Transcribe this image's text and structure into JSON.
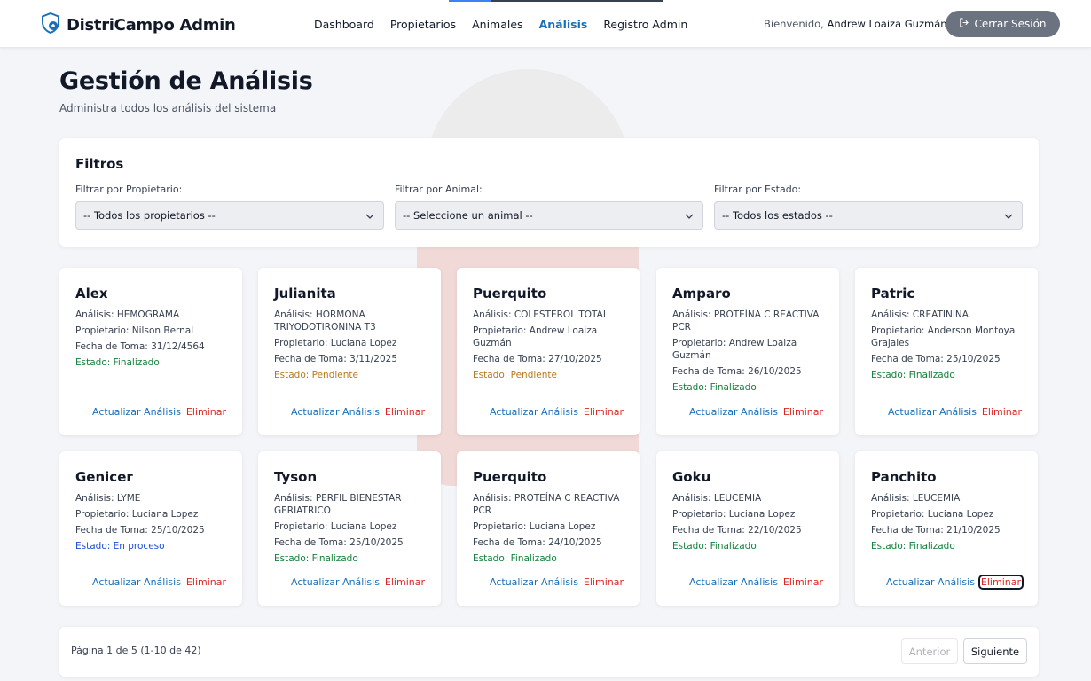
{
  "brand": {
    "name": "DistriCampo Admin"
  },
  "nav": {
    "items": [
      {
        "label": "Dashboard"
      },
      {
        "label": "Propietarios"
      },
      {
        "label": "Animales"
      },
      {
        "label": "Análisis"
      },
      {
        "label": "Registro Admin"
      }
    ],
    "active": "Análisis"
  },
  "user": {
    "welcome_prefix": "Bienvenido,",
    "name": "Andrew Loaiza Guzmán",
    "logout_label": "Cerrar Sesión"
  },
  "page": {
    "title": "Gestión de Análisis",
    "subtitle": "Administra todos los análisis del sistema"
  },
  "filters": {
    "title": "Filtros",
    "owner": {
      "label": "Filtrar por Propietario:",
      "value": "-- Todos los propietarios --"
    },
    "animal": {
      "label": "Filtrar por Animal:",
      "value": "-- Seleccione un animal --"
    },
    "status": {
      "label": "Filtrar por Estado:",
      "value": "-- Todos los estados --"
    }
  },
  "cards": [
    {
      "name": "Alex",
      "analysis": "Análisis: HEMOGRAMA",
      "owner": "Propietario: Nilson Bernal",
      "date": "Fecha de Toma: 31/12/4564",
      "status": "Estado: Finalizado",
      "update": "Actualizar Análisis",
      "delete": "Eliminar"
    },
    {
      "name": "Julianita",
      "analysis": "Análisis: HORMONA TRIYODOTIRONINA T3",
      "owner": "Propietario: Luciana Lopez",
      "date": "Fecha de Toma: 3/11/2025",
      "status": "Estado: Pendiente",
      "update": "Actualizar Análisis",
      "delete": "Eliminar"
    },
    {
      "name": "Puerquito",
      "analysis": "Análisis: COLESTEROL TOTAL",
      "owner": "Propietario: Andrew Loaiza Guzmán",
      "date": "Fecha de Toma: 27/10/2025",
      "status": "Estado: Pendiente",
      "update": "Actualizar Análisis",
      "delete": "Eliminar"
    },
    {
      "name": "Amparo",
      "analysis": "Análisis: PROTEÍNA C REACTIVA PCR",
      "owner": "Propietario: Andrew Loaiza Guzmán",
      "date": "Fecha de Toma: 26/10/2025",
      "status": "Estado: Finalizado",
      "update": "Actualizar Análisis",
      "delete": "Eliminar"
    },
    {
      "name": "Patric",
      "analysis": "Análisis: CREATININA",
      "owner": "Propietario: Anderson Montoya Grajales",
      "date": "Fecha de Toma: 25/10/2025",
      "status": "Estado: Finalizado",
      "update": "Actualizar Análisis",
      "delete": "Eliminar"
    },
    {
      "name": "Genicer",
      "analysis": "Análisis: LYME",
      "owner": "Propietario: Luciana Lopez",
      "date": "Fecha de Toma: 25/10/2025",
      "status": "Estado: En proceso",
      "update": "Actualizar Análisis",
      "delete": "Eliminar"
    },
    {
      "name": "Tyson",
      "analysis": "Análisis: PERFIL BIENESTAR GERIATRICO",
      "owner": "Propietario: Luciana Lopez",
      "date": "Fecha de Toma: 25/10/2025",
      "status": "Estado: Finalizado",
      "update": "Actualizar Análisis",
      "delete": "Eliminar"
    },
    {
      "name": "Puerquito",
      "analysis": "Análisis: PROTEÍNA C REACTIVA PCR",
      "owner": "Propietario: Luciana Lopez",
      "date": "Fecha de Toma: 24/10/2025",
      "status": "Estado: Finalizado",
      "update": "Actualizar Análisis",
      "delete": "Eliminar"
    },
    {
      "name": "Goku",
      "analysis": "Análisis: LEUCEMIA",
      "owner": "Propietario: Luciana Lopez",
      "date": "Fecha de Toma: 22/10/2025",
      "status": "Estado: Finalizado",
      "update": "Actualizar Análisis",
      "delete": "Eliminar"
    },
    {
      "name": "Panchito",
      "analysis": "Análisis: LEUCEMIA",
      "owner": "Propietario: Luciana Lopez",
      "date": "Fecha de Toma: 21/10/2025",
      "status": "Estado: Finalizado",
      "update": "Actualizar Análisis",
      "delete": "Eliminar"
    }
  ],
  "pagination": {
    "info": "Página 1 de 5 (1-10 de 42)",
    "prev_label": "Anterior",
    "next_label": "Siguiente"
  },
  "colors": {
    "accent": "#1a6fb8",
    "finalizado": "#15803d",
    "pendiente": "#b7791f",
    "en_proceso": "#1d4ed8",
    "delete": "#dc2626",
    "logout_bg": "#6b7280"
  }
}
